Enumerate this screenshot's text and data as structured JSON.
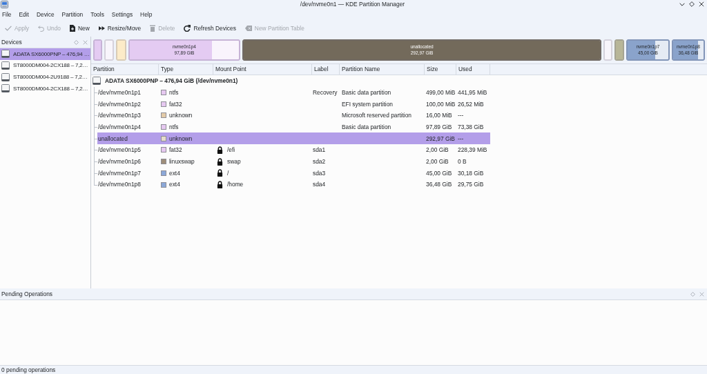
{
  "window": {
    "title": "/dev/nvme0n1 — KDE Partition Manager"
  },
  "menu": [
    "File",
    "Edit",
    "Device",
    "Partition",
    "Tools",
    "Settings",
    "Help"
  ],
  "toolbar": [
    {
      "label": "Apply",
      "kind": "apply",
      "disabled": true
    },
    {
      "label": "Undo",
      "kind": "undo",
      "disabled": true
    },
    {
      "label": "New",
      "kind": "new",
      "disabled": false
    },
    {
      "label": "Resize/Move",
      "kind": "resize",
      "disabled": false
    },
    {
      "label": "Delete",
      "kind": "delete",
      "disabled": true
    },
    {
      "label": "Refresh Devices",
      "kind": "refresh",
      "disabled": false
    },
    {
      "label": "New Partition Table",
      "kind": "table",
      "disabled": true
    }
  ],
  "devices_panel": {
    "title": "Devices",
    "items": [
      {
        "label": "ADATA SX6000PNP – 476,94 …",
        "selected": true
      },
      {
        "label": "ST8000DM004-2CX188 – 7,2…",
        "selected": false
      },
      {
        "label": "ST8000DM004-2U9188 – 7,2…",
        "selected": false
      },
      {
        "label": "ST8000DM004-2CX188 – 7,2…",
        "selected": false
      }
    ]
  },
  "partition_graph": {
    "segments": [
      {
        "color": "#e4cbf2",
        "level": 1
      },
      {
        "color": "#f8f5fb"
      },
      {
        "color": "#fcebc8",
        "level": 1
      },
      {
        "name": "nvme0n1p4",
        "size": "97,89 GiB",
        "color": "#e4cbf2",
        "level": 0.75
      },
      {
        "name": "unallocated",
        "size": "292,97 GiB",
        "color": "#736a5b",
        "level": 1
      },
      {
        "color": "#f8f5fb"
      },
      {
        "color": "#b8b698",
        "level": 1
      },
      {
        "name": "nvme0n1p7",
        "size": "45,00 GiB",
        "color": "#8aa3cb",
        "level": 0.67
      },
      {
        "name": "nvme0n1p8",
        "size": "36,48 GiB",
        "color": "#8aa3cb",
        "level": 0.82
      }
    ]
  },
  "table": {
    "columns": [
      "Partition",
      "Type",
      "Mount Point",
      "Label",
      "Partition Name",
      "Size",
      "Used"
    ],
    "rows": [
      {
        "partition": "ADATA SX6000PNP – 476,94 GiB (/dev/nvme0n1)",
        "selected": false,
        "children": [
          {
            "partition": "/dev/nvme0n1p1",
            "type": "ntfs",
            "color": "#e6c8f0",
            "locked": false,
            "label": "Recovery",
            "partition_name": "Basic data partition",
            "size": "499,00 MiB",
            "used": "441,95 MiB",
            "selected": false
          },
          {
            "partition": "/dev/nvme0n1p2",
            "type": "fat32",
            "color": "#e6c8f0",
            "locked": false,
            "partition_name": "EFI system partition",
            "size": "100,00 MiB",
            "used": "26,52 MiB",
            "selected": false
          },
          {
            "partition": "/dev/nvme0n1p3",
            "type": "unknown",
            "color": "#e3cba8",
            "locked": false,
            "partition_name": "Microsoft reserved partition",
            "size": "16,00 MiB",
            "used": "---",
            "selected": false
          },
          {
            "partition": "/dev/nvme0n1p4",
            "type": "ntfs",
            "color": "#e6c8f0",
            "locked": false,
            "partition_name": "Basic data partition",
            "size": "97,89 GiB",
            "used": "73,38 GiB",
            "selected": false
          },
          {
            "partition": "unallocated",
            "type": "unknown",
            "color": "#e6dccb",
            "locked": false,
            "size": "292,97 GiB",
            "used": "---",
            "selected": true
          },
          {
            "partition": "/dev/nvme0n1p5",
            "type": "fat32",
            "color": "#e6c8f0",
            "locked": true,
            "mount_point": "/efi",
            "label": "sda1",
            "size": "2,00 GiB",
            "used": "228,39 MiB",
            "selected": false
          },
          {
            "partition": "/dev/nvme0n1p6",
            "type": "linuxswap",
            "color": "#9e8e7a",
            "locked": true,
            "mount_point": "swap",
            "label": "sda2",
            "size": "2,00 GiB",
            "used": "0 B",
            "selected": false
          },
          {
            "partition": "/dev/nvme0n1p7",
            "type": "ext4",
            "color": "#8ca8d8",
            "locked": true,
            "mount_point": "/",
            "label": "sda3",
            "size": "45,00 GiB",
            "used": "30,18 GiB",
            "selected": false
          },
          {
            "partition": "/dev/nvme0n1p8",
            "type": "ext4",
            "color": "#8ca8d8",
            "locked": true,
            "mount_point": "/home",
            "label": "sda4",
            "size": "36,48 GiB",
            "used": "29,75 GiB",
            "selected": false
          }
        ]
      }
    ]
  },
  "pending_operations": {
    "title": "Pending Operations"
  },
  "status_bar": "0 pending operations"
}
